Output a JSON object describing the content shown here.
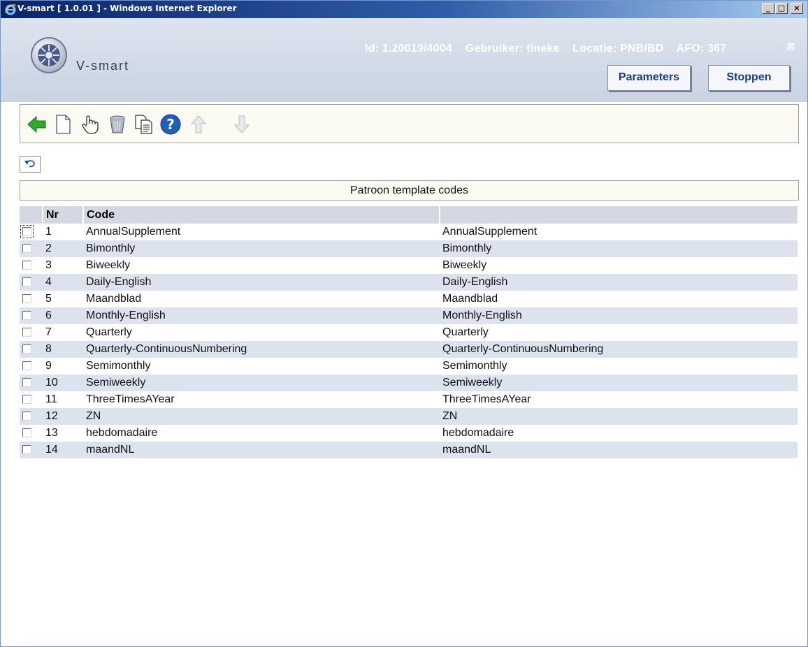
{
  "window": {
    "title": "V-smart [ 1.0.01 ] - Windows Internet Explorer",
    "buttons": {
      "minimize": "_",
      "maximize": "□",
      "close": "×"
    }
  },
  "header": {
    "brand": "V-smart",
    "id": "Id: 1.20019/4004",
    "user": "Gebruiker: tineke",
    "location": "Locatie: PNB/BD",
    "afo": "AFO: 367",
    "close_glyph": "⊠",
    "parameters_label": "Parameters",
    "stop_label": "Stoppen"
  },
  "toolbar": {
    "icons": [
      "back-arrow-icon",
      "new-document-icon",
      "hand-select-icon",
      "trash-icon",
      "copy-icon",
      "help-icon",
      "arrow-up-icon",
      "arrow-down-icon"
    ]
  },
  "panel": {
    "title": "Patroon template codes"
  },
  "table": {
    "headers": {
      "nr": "Nr",
      "code": "Code",
      "description": ""
    },
    "rows": [
      {
        "nr": "1",
        "code": "AnnualSupplement",
        "description": "AnnualSupplement"
      },
      {
        "nr": "2",
        "code": "Bimonthly",
        "description": "Bimonthly"
      },
      {
        "nr": "3",
        "code": "Biweekly",
        "description": "Biweekly"
      },
      {
        "nr": "4",
        "code": "Daily-English",
        "description": "Daily-English"
      },
      {
        "nr": "5",
        "code": "Maandblad",
        "description": "Maandblad"
      },
      {
        "nr": "6",
        "code": "Monthly-English",
        "description": "Monthly-English"
      },
      {
        "nr": "7",
        "code": "Quarterly",
        "description": "Quarterly"
      },
      {
        "nr": "8",
        "code": "Quarterly-ContinuousNumbering",
        "description": "Quarterly-ContinuousNumbering"
      },
      {
        "nr": "9",
        "code": "Semimonthly",
        "description": "Semimonthly"
      },
      {
        "nr": "10",
        "code": "Semiweekly",
        "description": "Semiweekly"
      },
      {
        "nr": "11",
        "code": "ThreeTimesAYear",
        "description": "ThreeTimesAYear"
      },
      {
        "nr": "12",
        "code": "ZN",
        "description": "ZN"
      },
      {
        "nr": "13",
        "code": "hebdomadaire",
        "description": "hebdomadaire"
      },
      {
        "nr": "14",
        "code": "maandNL",
        "description": "maandNL"
      }
    ]
  },
  "colors": {
    "title_bar": "#0a246a",
    "header_bg": "#c9d3e2",
    "button_text": "#1b3a8c",
    "row_alt": "#dce3ef",
    "table_header": "#d3d8e3",
    "back_arrow": "#2ea82e"
  }
}
